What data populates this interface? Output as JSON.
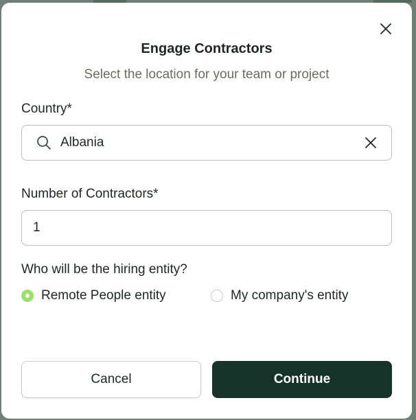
{
  "colors": {
    "accent_dark": "#173329",
    "radio_selected": "#9be06f",
    "subtitle_text": "#6b6b5f"
  },
  "modal": {
    "title": "Engage Contractors",
    "subtitle": "Select the location for your team or project",
    "close_icon": "close-icon",
    "country": {
      "label": "Country*",
      "value": "Albania",
      "icon": "search-icon",
      "clear_icon": "clear-icon"
    },
    "contractors": {
      "label": "Number of Contractors*",
      "value": "1"
    },
    "hiring_entity": {
      "question": "Who will be the hiring entity?",
      "options": [
        {
          "label": "Remote People entity",
          "selected": true
        },
        {
          "label": "My company's entity",
          "selected": false
        }
      ]
    },
    "buttons": {
      "cancel_label": "Cancel",
      "continue_label": "Continue"
    }
  }
}
